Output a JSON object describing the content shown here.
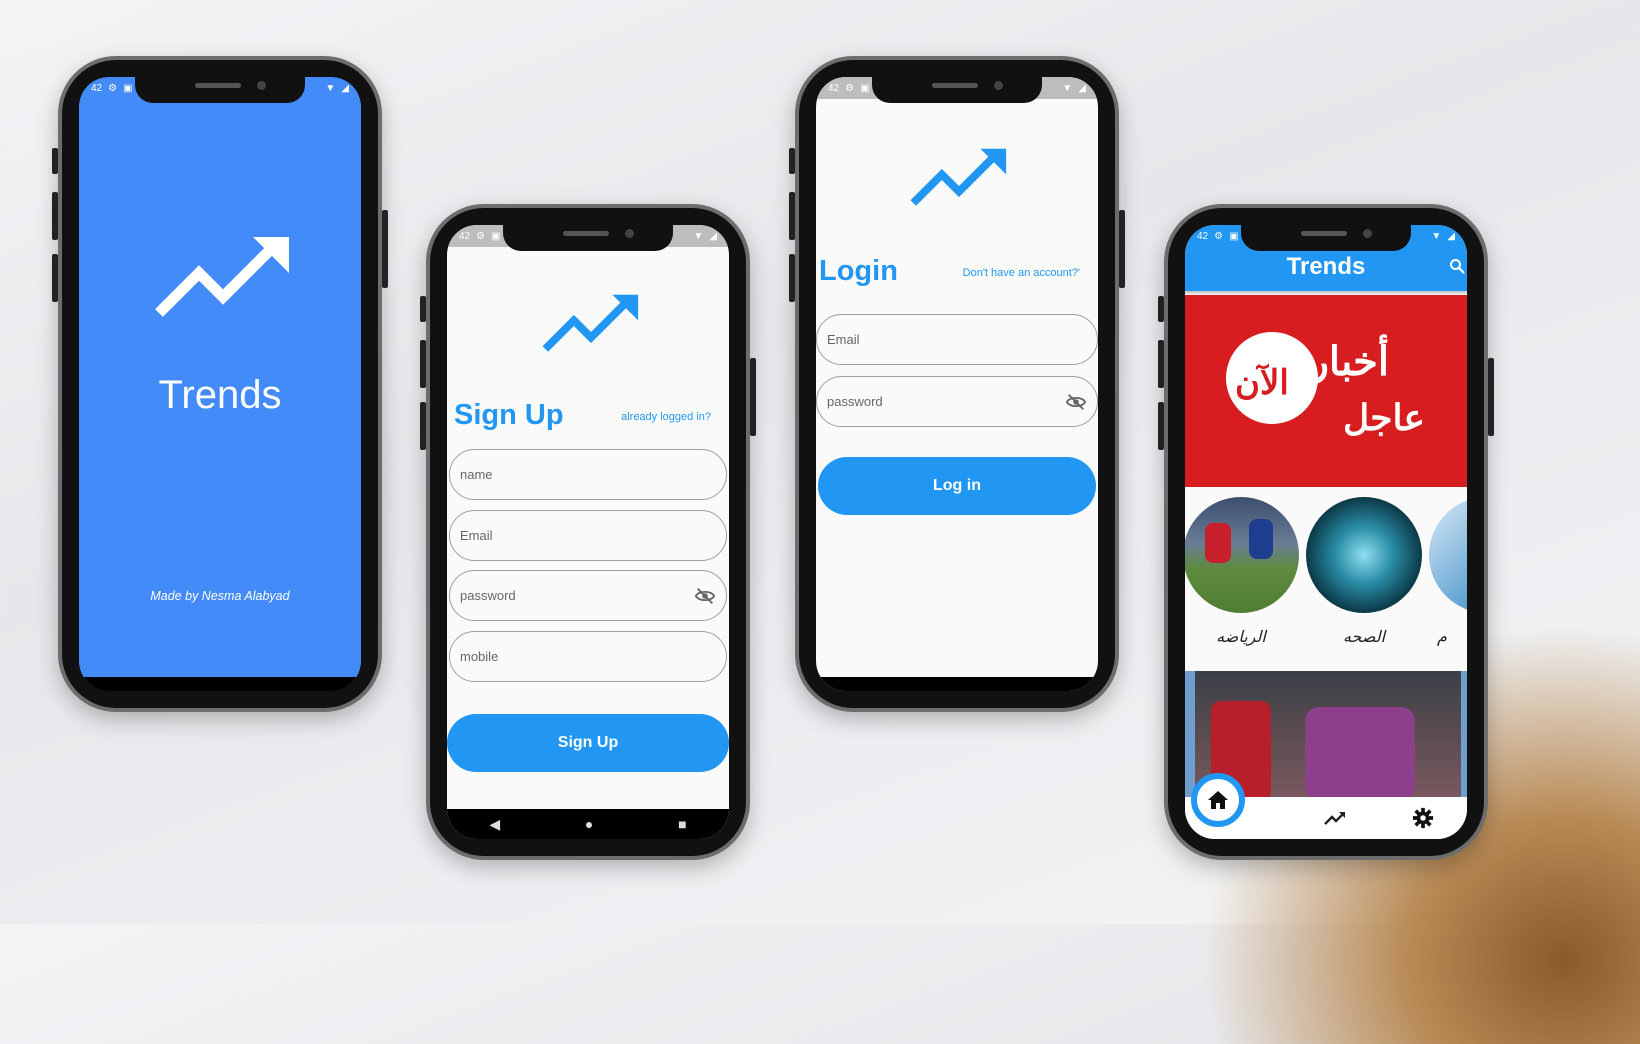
{
  "status": {
    "time": "42"
  },
  "colors": {
    "brand": "#438bf8",
    "primary": "#2196f3",
    "banner_red": "#d71d1f"
  },
  "splash": {
    "title": "Trends",
    "credit": "Made by  Nesma Alabyad"
  },
  "signup": {
    "title": "Sign Up",
    "link": "already logged in?",
    "fields": {
      "name": "name",
      "email": "Email",
      "password": "password",
      "mobile": "mobile"
    },
    "button": "Sign Up"
  },
  "login": {
    "title": "Login",
    "link": "Don't have an account?'",
    "fields": {
      "email": "Email",
      "password": "password"
    },
    "button": "Log in"
  },
  "home": {
    "title": "Trends",
    "banner": {
      "line1": "أخبار",
      "line1_red": "الآن",
      "line2": "عاجل"
    },
    "categories": [
      {
        "label": "الرياضه"
      },
      {
        "label": "الصحه"
      },
      {
        "label": "م"
      }
    ],
    "nav": [
      "home-icon",
      "trending-icon",
      "settings-icon"
    ]
  },
  "icons": {
    "status": [
      "settings-icon",
      "image-icon",
      "wifi-icon",
      "battery-icon"
    ],
    "nav": [
      "back-icon",
      "home-circle-icon",
      "recents-icon"
    ]
  }
}
